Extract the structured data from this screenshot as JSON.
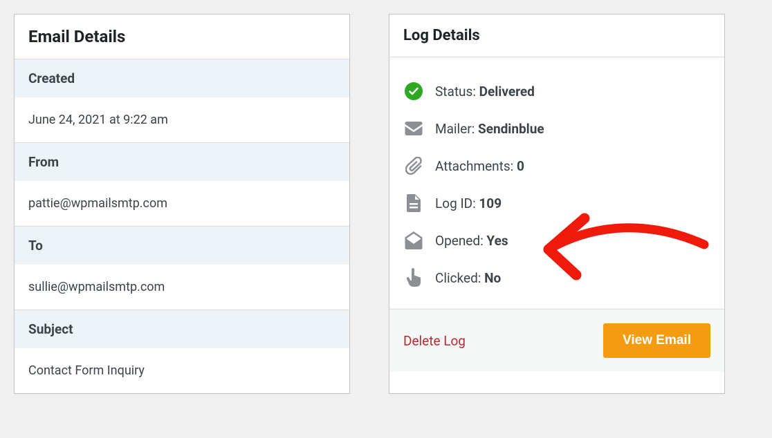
{
  "emailDetails": {
    "title": "Email Details",
    "fields": {
      "createdLabel": "Created",
      "createdValue": "June 24, 2021 at 9:22 am",
      "fromLabel": "From",
      "fromValue": "pattie@wpmailsmtp.com",
      "toLabel": "To",
      "toValue": "sullie@wpmailsmtp.com",
      "subjectLabel": "Subject",
      "subjectValue": "Contact Form Inquiry"
    }
  },
  "logDetails": {
    "title": "Log Details",
    "status": {
      "label": "Status: ",
      "value": "Delivered"
    },
    "mailer": {
      "label": "Mailer: ",
      "value": "Sendinblue"
    },
    "attachments": {
      "label": "Attachments: ",
      "value": "0"
    },
    "logId": {
      "label": "Log ID: ",
      "value": "109"
    },
    "opened": {
      "label": "Opened: ",
      "value": "Yes"
    },
    "clicked": {
      "label": "Clicked: ",
      "value": "No"
    },
    "deleteLabel": "Delete Log",
    "viewLabel": "View Email"
  }
}
